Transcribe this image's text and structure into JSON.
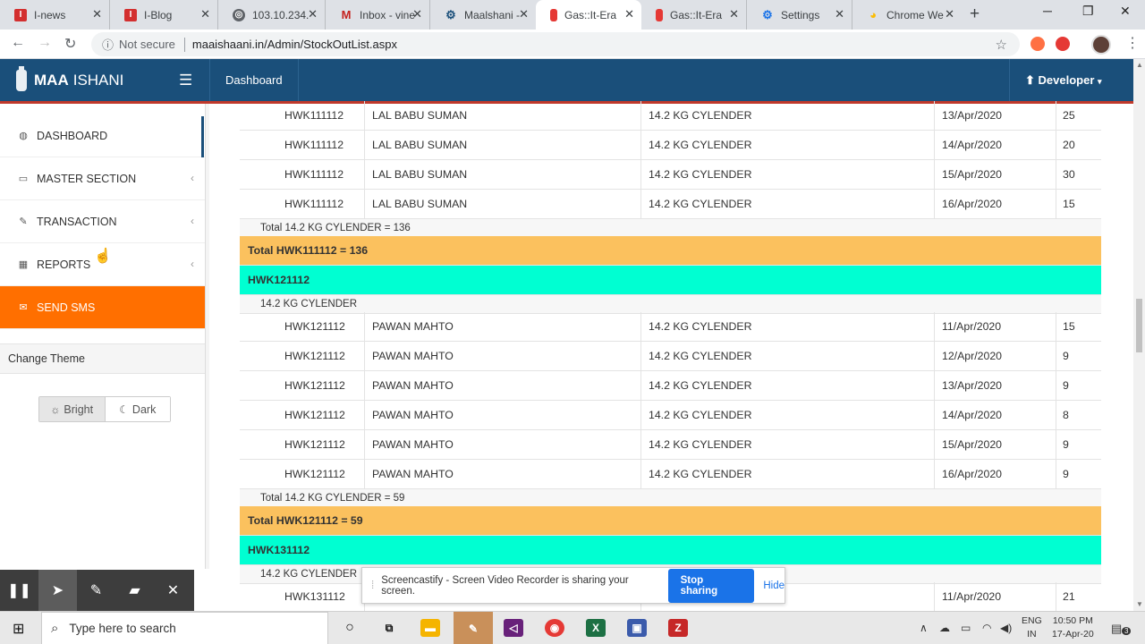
{
  "browser": {
    "tabs": [
      {
        "title": "I-news",
        "favicon": "I",
        "color": "#d32f2f"
      },
      {
        "title": "I-Blog",
        "favicon": "I",
        "color": "#d32f2f"
      },
      {
        "title": "103.10.234.",
        "favicon": "◎",
        "color": "#5f6368"
      },
      {
        "title": "Inbox - vine",
        "favicon": "M",
        "color": "#c5221f"
      },
      {
        "title": "Maalshani -",
        "favicon": "⚙",
        "color": "#1a4f7a"
      },
      {
        "title": "Gas::It-Era",
        "favicon": "▮",
        "color": "#e53935"
      },
      {
        "title": "Gas::It-Era",
        "favicon": "▮",
        "color": "#e53935"
      },
      {
        "title": "Settings",
        "favicon": "⚙",
        "color": "#1a73e8"
      },
      {
        "title": "Chrome We",
        "favicon": "◕",
        "color": "#fbbc04"
      }
    ],
    "not_secure": "Not secure",
    "url": "maaishaani.in/Admin/StockOutList.aspx"
  },
  "header": {
    "brand_bold": "MAA",
    "brand_rest": "ISHANI",
    "dashboard": "Dashboard",
    "user": "Developer"
  },
  "sidebar": {
    "items": [
      {
        "label": "DASHBOARD",
        "icon": "dashboard-icon"
      },
      {
        "label": "MASTER SECTION",
        "icon": "desktop-icon"
      },
      {
        "label": "TRANSACTION",
        "icon": "edit-icon"
      },
      {
        "label": "REPORTS",
        "icon": "table-icon"
      },
      {
        "label": "SEND SMS",
        "icon": "envelope-icon"
      }
    ],
    "theme_title": "Change Theme",
    "bright": "Bright",
    "dark": "Dark"
  },
  "table": {
    "group1_rows": [
      {
        "code": "HWK111112",
        "name": "LAL BABU SUMAN",
        "item": "14.2 KG CYLENDER",
        "date": "13/Apr/2020",
        "qty": "25"
      },
      {
        "code": "HWK111112",
        "name": "LAL BABU SUMAN",
        "item": "14.2 KG CYLENDER",
        "date": "14/Apr/2020",
        "qty": "20"
      },
      {
        "code": "HWK111112",
        "name": "LAL BABU SUMAN",
        "item": "14.2 KG CYLENDER",
        "date": "15/Apr/2020",
        "qty": "30"
      },
      {
        "code": "HWK111112",
        "name": "LAL BABU SUMAN",
        "item": "14.2 KG CYLENDER",
        "date": "16/Apr/2020",
        "qty": "15"
      }
    ],
    "group1_subtotal": "Total 14.2 KG CYLENDER = 136",
    "group1_total": "Total HWK111112 = 136",
    "group2_header": "HWK121112",
    "group2_item": "14.2 KG CYLENDER",
    "group2_rows": [
      {
        "code": "HWK121112",
        "name": "PAWAN MAHTO",
        "item": "14.2 KG CYLENDER",
        "date": "11/Apr/2020",
        "qty": "15"
      },
      {
        "code": "HWK121112",
        "name": "PAWAN MAHTO",
        "item": "14.2 KG CYLENDER",
        "date": "12/Apr/2020",
        "qty": "9"
      },
      {
        "code": "HWK121112",
        "name": "PAWAN MAHTO",
        "item": "14.2 KG CYLENDER",
        "date": "13/Apr/2020",
        "qty": "9"
      },
      {
        "code": "HWK121112",
        "name": "PAWAN MAHTO",
        "item": "14.2 KG CYLENDER",
        "date": "14/Apr/2020",
        "qty": "8"
      },
      {
        "code": "HWK121112",
        "name": "PAWAN MAHTO",
        "item": "14.2 KG CYLENDER",
        "date": "15/Apr/2020",
        "qty": "9"
      },
      {
        "code": "HWK121112",
        "name": "PAWAN MAHTO",
        "item": "14.2 KG CYLENDER",
        "date": "16/Apr/2020",
        "qty": "9"
      }
    ],
    "group2_subtotal": "Total 14.2 KG CYLENDER = 59",
    "group2_total": "Total HWK121112 = 59",
    "group3_header": "HWK131112",
    "group3_item": "14.2 KG CYLENDER",
    "group3_row": {
      "code": "HWK131112",
      "name": "",
      "item": "",
      "date": "11/Apr/2020",
      "qty": "21"
    }
  },
  "screencastify": {
    "message": "Screencastify - Screen Video Recorder is sharing your screen.",
    "stop": "Stop sharing",
    "hide": "Hide"
  },
  "taskbar": {
    "search_placeholder": "Type here to search",
    "lang1": "ENG",
    "lang2": "IN",
    "time": "10:50 PM",
    "date": "17-Apr-20",
    "notif_count": "3"
  }
}
